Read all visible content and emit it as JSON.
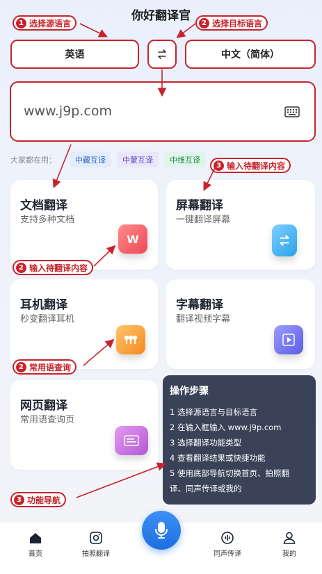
{
  "app": {
    "title": "你好翻译官"
  },
  "languages": {
    "source": "英语",
    "target": "中文（简体）"
  },
  "input": {
    "value": "www.j9p.com"
  },
  "common": {
    "hint": "大家都在用：",
    "tags": [
      "中藏互译",
      "中蒙互译",
      "中维互译"
    ]
  },
  "cards": [
    {
      "title": "文档翻译",
      "subtitle": "支持多种文档",
      "icon": "W"
    },
    {
      "title": "屏幕翻译",
      "subtitle": "一键翻译屏幕"
    },
    {
      "title": "耳机翻译",
      "subtitle": "秒变翻译耳机"
    },
    {
      "title": "字幕翻译",
      "subtitle": "翻译视频字幕"
    },
    {
      "title": "网页翻译",
      "subtitle": "常用语查询页"
    }
  ],
  "callouts": [
    {
      "num": "1",
      "text": "选择源语言"
    },
    {
      "num": "2",
      "text": "选择目标语言"
    },
    {
      "num": "3",
      "text": "输入待翻译内容"
    },
    {
      "num": "2",
      "text": "输入待翻译内容"
    },
    {
      "num": "2",
      "text": "常用语查询"
    },
    {
      "num": "3",
      "text": "功能导航"
    }
  ],
  "steps": {
    "title": "操作步骤",
    "lines": [
      "1 选择源语言与目标语言",
      "2 在输入框输入 www.j9p.com",
      "3 选择翻译功能类型",
      "4 查看翻译结果或快捷功能",
      "5 使用底部导航切换首页、拍照翻",
      "译、同声传译或我的"
    ]
  },
  "nav": {
    "home": "首页",
    "photo": "拍照翻译",
    "simul": "同声传译",
    "mine": "我的"
  },
  "colors": {
    "accent": "#c8232c",
    "brand": "#1e6fe0"
  }
}
